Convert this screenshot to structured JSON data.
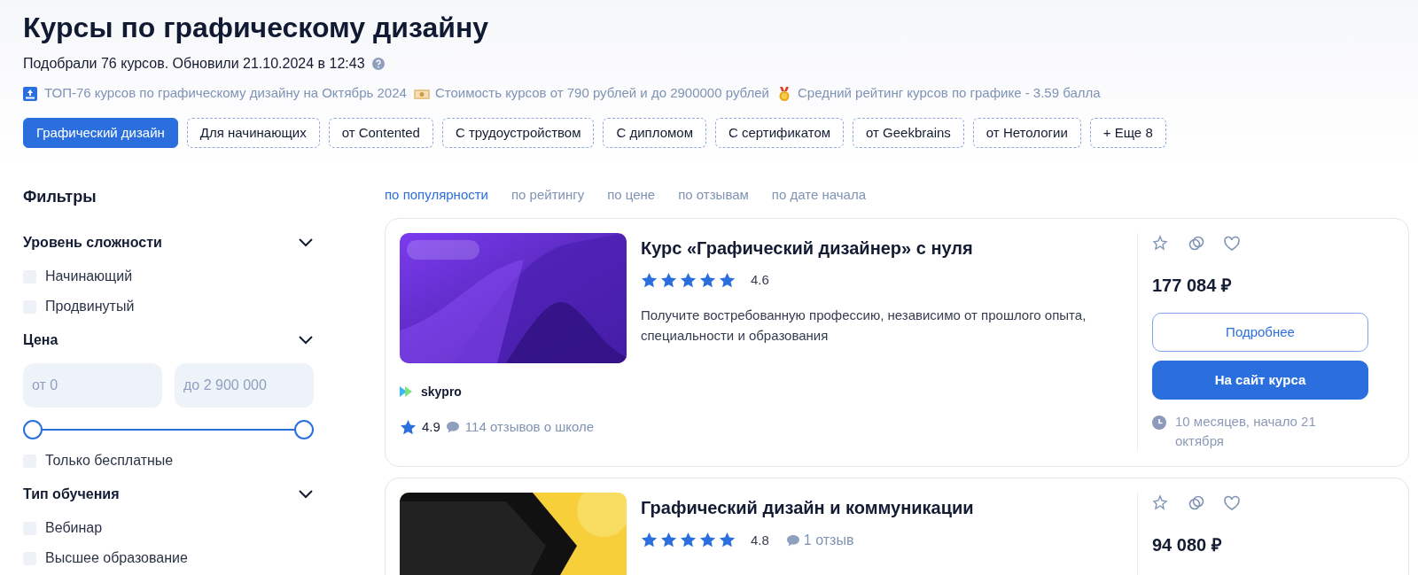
{
  "header": {
    "title": "Курсы по графическому дизайну",
    "subtitle": "Подобрали 76 курсов. Обновили 21.10.2024 в 12:43"
  },
  "highlights": [
    {
      "kind": "top",
      "text": "ТОП-76 курсов по графическому дизайну на Октябрь 2024"
    },
    {
      "kind": "money",
      "text": "Стоимость курсов от 790 рублей и до 2900000 рублей"
    },
    {
      "kind": "medal",
      "text": "Средний рейтинг курсов по графике - 3.59 балла"
    }
  ],
  "chips": [
    {
      "label": "Графический дизайн",
      "selected": true
    },
    {
      "label": "Для начинающих",
      "selected": false
    },
    {
      "label": "от Contented",
      "selected": false
    },
    {
      "label": "С трудоустройством",
      "selected": false
    },
    {
      "label": "С дипломом",
      "selected": false
    },
    {
      "label": "С сертификатом",
      "selected": false
    },
    {
      "label": "от Geekbrains",
      "selected": false
    },
    {
      "label": "от Нетологии",
      "selected": false
    },
    {
      "label": "+ Еще 8",
      "selected": false
    }
  ],
  "filters": {
    "title": "Фильтры",
    "sections": [
      {
        "kind": "checkboxes",
        "title": "Уровень сложности",
        "expanded": true,
        "options": [
          {
            "label": "Начинающий",
            "checked": false
          },
          {
            "label": "Продвинутый",
            "checked": false
          }
        ]
      },
      {
        "kind": "price",
        "title": "Цена",
        "expanded": true,
        "fields": [
          {
            "placeholder": "от 0"
          },
          {
            "placeholder": "до 2 900 000"
          }
        ],
        "slider": {
          "level": 1
        },
        "options": [
          {
            "label": "Только бесплатные",
            "checked": false
          }
        ]
      },
      {
        "kind": "checkboxes",
        "title": "Тип обучения",
        "expanded": true,
        "options": [
          {
            "label": "Вебинар",
            "checked": false
          },
          {
            "label": "Высшее образование",
            "checked": false
          }
        ]
      }
    ]
  },
  "sort": [
    {
      "label": "по популярности",
      "selected": true
    },
    {
      "label": "по рейтингу",
      "selected": false
    },
    {
      "label": "по цене",
      "selected": false
    },
    {
      "label": "по отзывам",
      "selected": false
    },
    {
      "label": "по дате начала",
      "selected": false
    }
  ],
  "courses": [
    {
      "title": "Курс «Графический дизайнер» с нуля",
      "stars": 5,
      "rating": "4.6",
      "description": "Получите востребованную профессию, независимо от прошлого опыта, специальности и образования",
      "school": {
        "name": "skypro",
        "rating": "4.9",
        "reviews": "114 отзывов о школе"
      },
      "price": "177 084 ₽",
      "buttons": [
        {
          "kind": "outline",
          "label": "Подробнее"
        },
        {
          "kind": "primary",
          "label": "На сайт курса"
        }
      ],
      "duration": "10 месяцев, начало 21 октября"
    },
    {
      "title": "Графический дизайн и коммуникации",
      "stars": 5,
      "rating": "4.8",
      "reviews": "1 отзыв",
      "price": "94 080 ₽"
    }
  ]
}
